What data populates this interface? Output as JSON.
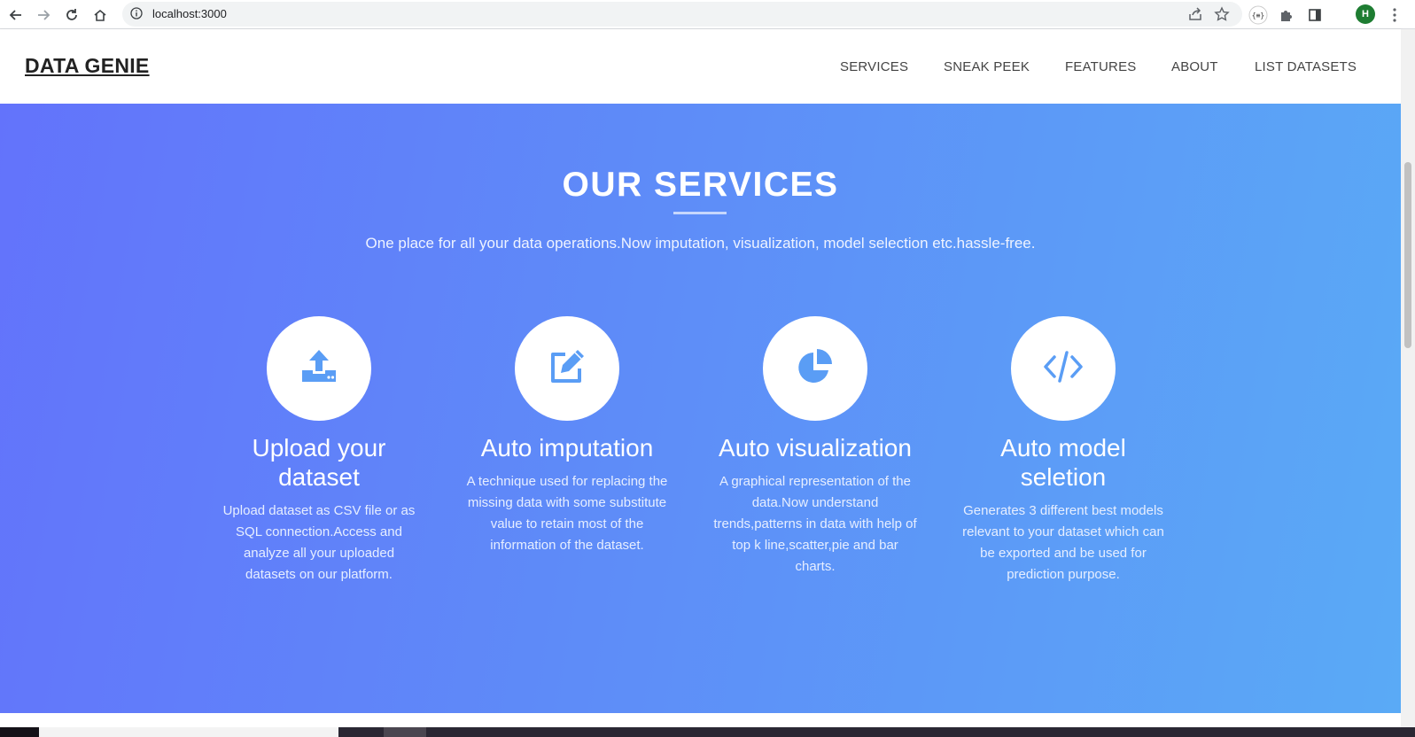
{
  "browser": {
    "url": "localhost:3000",
    "profile_initial": "H"
  },
  "site": {
    "brand": "DATA GENIE",
    "nav": [
      "SERVICES",
      "SNEAK PEEK",
      "FEATURES",
      "ABOUT",
      "LIST DATASETS"
    ]
  },
  "services": {
    "title": "OUR SERVICES",
    "subtitle": "One place for all your data operations.Now imputation, visualization, model selection etc.hassle-free.",
    "items": [
      {
        "icon": "upload-icon",
        "title": "Upload your dataset",
        "description": "Upload dataset as CSV file or as SQL connection.Access and analyze all your uploaded datasets on our platform."
      },
      {
        "icon": "edit-icon",
        "title": "Auto imputation",
        "description": "A technique used for replacing the missing data with some substitute value to retain most of the information of the dataset."
      },
      {
        "icon": "pie-chart-icon",
        "title": "Auto visualization",
        "description": "A graphical representation of the data.Now understand trends,patterns in data with help of top k line,scatter,pie and bar charts."
      },
      {
        "icon": "code-icon",
        "title": "Auto model seletion",
        "description": "Generates 3 different best models relevant to your dataset which can be exported and be used for prediction purpose."
      }
    ]
  },
  "colors": {
    "accent": "#5a9df5",
    "gradient_start": "#6373fb",
    "gradient_end": "#5aaaf6"
  }
}
